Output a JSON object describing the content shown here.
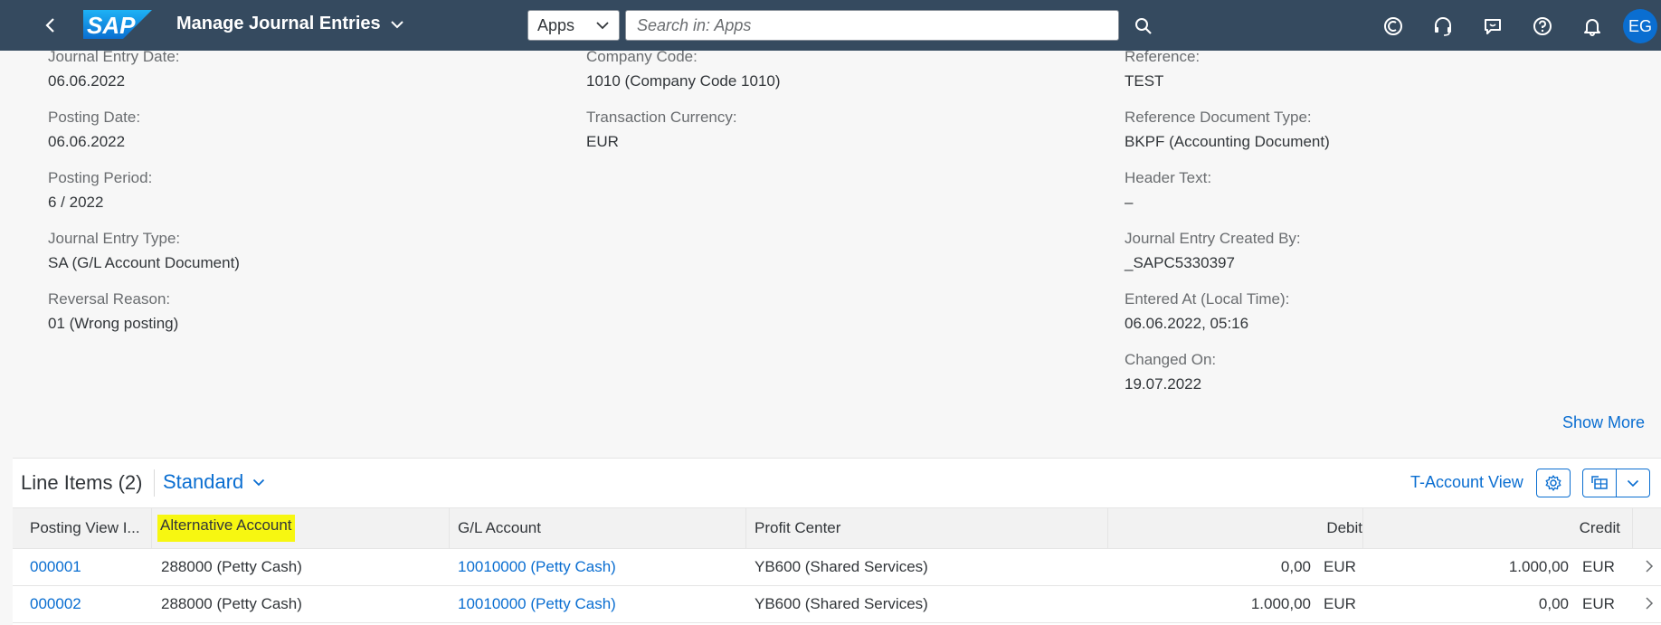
{
  "shell": {
    "title": "Manage Journal Entries",
    "scope": "Apps",
    "search_placeholder": "Search in: Apps",
    "avatar_initials": "EG",
    "brand_color": "#354a5f"
  },
  "header_fields": {
    "col1": [
      {
        "label": "Journal Entry Date:",
        "value": "06.06.2022"
      },
      {
        "label": "Posting Date:",
        "value": "06.06.2022"
      },
      {
        "label": "Posting Period:",
        "value": "6 / 2022"
      },
      {
        "label": "Journal Entry Type:",
        "value": "SA (G/L Account Document)"
      },
      {
        "label": "Reversal Reason:",
        "value": "01 (Wrong posting)"
      }
    ],
    "col2": [
      {
        "label": "Company Code:",
        "value": "1010 (Company Code 1010)"
      },
      {
        "label": "Transaction Currency:",
        "value": "EUR"
      }
    ],
    "col3": [
      {
        "label": "Reference:",
        "value": "TEST"
      },
      {
        "label": "Reference Document Type:",
        "value": "BKPF (Accounting Document)"
      },
      {
        "label": "Header Text:",
        "value": "–"
      },
      {
        "label": "Journal Entry Created By:",
        "value": "_SAPC5330397"
      },
      {
        "label": "Entered At (Local Time):",
        "value": "06.06.2022, 05:16"
      },
      {
        "label": "Changed On:",
        "value": "19.07.2022"
      }
    ]
  },
  "show_more": "Show More",
  "line_items": {
    "title": "Line Items (2)",
    "variant": "Standard",
    "taccount_view": "T-Account View",
    "columns": {
      "posting_view_item": "Posting View I...",
      "alternative_account": "Alternative Account",
      "gl_account": "G/L Account",
      "profit_center": "Profit Center",
      "debit": "Debit",
      "credit": "Credit"
    },
    "rows": [
      {
        "item": "000001",
        "alt_account": "288000 (Petty Cash)",
        "gl_account": "10010000 (Petty Cash)",
        "profit_center": "YB600 (Shared Services)",
        "debit": "0,00",
        "debit_cur": "EUR",
        "credit": "1.000,00",
        "credit_cur": "EUR"
      },
      {
        "item": "000002",
        "alt_account": "288000 (Petty Cash)",
        "gl_account": "10010000 (Petty Cash)",
        "profit_center": "YB600 (Shared Services)",
        "debit": "1.000,00",
        "debit_cur": "EUR",
        "credit": "0,00",
        "credit_cur": "EUR"
      }
    ]
  },
  "colors": {
    "link": "#0a6ed1",
    "highlight": "#f7f711"
  }
}
